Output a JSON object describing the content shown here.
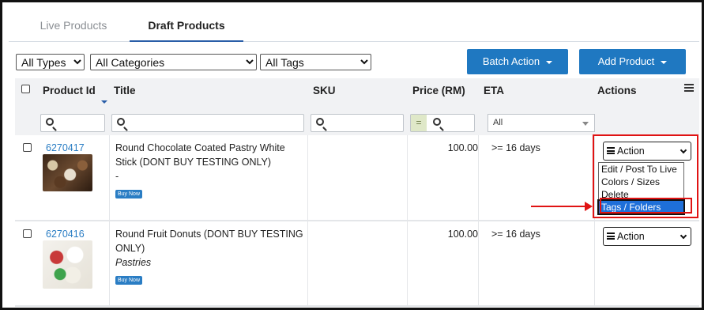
{
  "tabs": {
    "live": "Live Products",
    "draft": "Draft Products"
  },
  "filters": {
    "types": "All Types",
    "categories": "All Categories",
    "tags": "All Tags"
  },
  "buttons": {
    "batch_action": "Batch Action",
    "add_product": "Add Product"
  },
  "columns": {
    "product_id": "Product Id",
    "title": "Title",
    "sku": "SKU",
    "price": "Price (RM)",
    "eta": "ETA",
    "actions": "Actions"
  },
  "column_filters": {
    "price_operator": "=",
    "eta": "All"
  },
  "rows": [
    {
      "id": "6270417",
      "title": "Round Chocolate Coated Pastry White Stick (DONT BUY TESTING ONLY)",
      "subtitle": "-",
      "badge": "Buy Now",
      "sku": "",
      "price": "100.00",
      "eta": ">= 16 days",
      "action": "Action"
    },
    {
      "id": "6270416",
      "title": "Round Fruit Donuts (DONT BUY TESTING ONLY)",
      "subtitle": "Pastries",
      "badge": "Buy Now",
      "sku": "",
      "price": "100.00",
      "eta": ">= 16 days",
      "action": "Action"
    }
  ],
  "action_menu": {
    "items": [
      "Edit / Post To Live",
      "Colors / Sizes",
      "Delete",
      "Tags / Folders"
    ],
    "highlighted": "Tags / Folders"
  },
  "colors": {
    "accent": "#1f78c1",
    "link": "#2a7dc4",
    "annotation": "#e01313",
    "highlight": "#1e6fd9"
  }
}
